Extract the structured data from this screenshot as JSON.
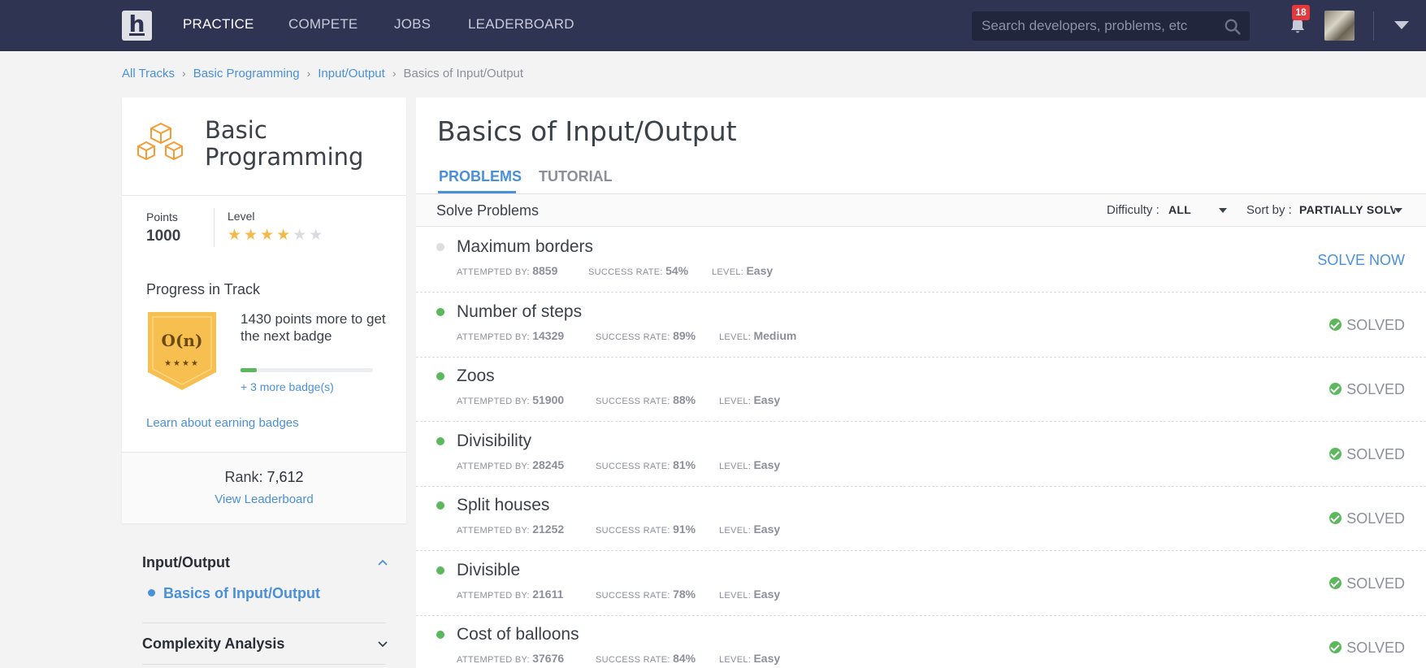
{
  "nav": {
    "logo": "h",
    "items": [
      "PRACTICE",
      "COMPETE",
      "JOBS",
      "LEADERBOARD"
    ],
    "active": "PRACTICE",
    "search_placeholder": "Search developers, problems, etc",
    "notifications": "18"
  },
  "breadcrumb": [
    "All Tracks",
    "Basic Programming",
    "Input/Output",
    "Basics of Input/Output"
  ],
  "track": {
    "title_line1": "Basic",
    "title_line2": "Programming",
    "points_label": "Points",
    "points": "1000",
    "level_label": "Level",
    "level_stars": 4,
    "level_max": 6,
    "progress_title": "Progress in Track",
    "badge_symbol": "O(n)",
    "badge_stars": "★★★★",
    "next_badge_text": "1430 points more to get the next badge",
    "progress_fraction": 0.12,
    "more_badges": "+ 3 more badge(s)",
    "learn_link": "Learn about earning badges",
    "rank_label": "Rank:",
    "rank": "7,612",
    "view_leaderboard": "View Leaderboard"
  },
  "sections": [
    {
      "title": "Input/Output",
      "expanded": true,
      "sub": "Basics of Input/Output"
    },
    {
      "title": "Complexity Analysis",
      "expanded": false
    }
  ],
  "main": {
    "title": "Basics of Input/Output",
    "tabs": [
      "PROBLEMS",
      "TUTORIAL"
    ],
    "active_tab": "PROBLEMS",
    "solve_label": "Solve Problems",
    "difficulty_label": "Difficulty :",
    "difficulty_value": "ALL",
    "sort_label": "Sort by :",
    "sort_value": "PARTIALLY SOLVED",
    "meta_labels": {
      "attempted": "ATTEMPTED BY:",
      "success": "SUCCESS RATE:",
      "level": "LEVEL:"
    },
    "problems": [
      {
        "name": "Maximum borders",
        "attempted": "8859",
        "success": "54%",
        "level": "Easy",
        "status": "SOLVE NOW",
        "solved": false
      },
      {
        "name": "Number of steps",
        "attempted": "14329",
        "success": "89%",
        "level": "Medium",
        "status": "SOLVED",
        "solved": true
      },
      {
        "name": "Zoos",
        "attempted": "51900",
        "success": "88%",
        "level": "Easy",
        "status": "SOLVED",
        "solved": true
      },
      {
        "name": "Divisibility",
        "attempted": "28245",
        "success": "81%",
        "level": "Easy",
        "status": "SOLVED",
        "solved": true
      },
      {
        "name": "Split houses",
        "attempted": "21252",
        "success": "91%",
        "level": "Easy",
        "status": "SOLVED",
        "solved": true
      },
      {
        "name": "Divisible",
        "attempted": "21611",
        "success": "78%",
        "level": "Easy",
        "status": "SOLVED",
        "solved": true
      },
      {
        "name": "Cost of balloons",
        "attempted": "37676",
        "success": "84%",
        "level": "Easy",
        "status": "SOLVED",
        "solved": true
      }
    ]
  },
  "colors": {
    "nav_bg": "#2f3452",
    "accent": "#4a90d9",
    "solved_green": "#5cb85c",
    "star": "#f5b94a",
    "badge_gold": "#f7bf4f"
  }
}
